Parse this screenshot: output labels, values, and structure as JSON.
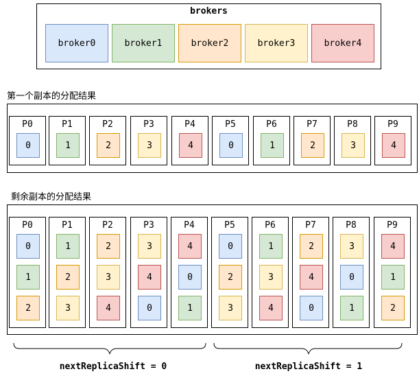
{
  "colors": {
    "0": {
      "fill": "#dae8fc",
      "stroke": "#6c8ebf"
    },
    "1": {
      "fill": "#d5e8d4",
      "stroke": "#82b366"
    },
    "2": {
      "fill": "#ffe6cc",
      "stroke": "#d79b00"
    },
    "3": {
      "fill": "#fff2cc",
      "stroke": "#d6b656"
    },
    "4": {
      "fill": "#f8cecc",
      "stroke": "#b85450"
    }
  },
  "brokers": {
    "title": "brokers",
    "items": [
      {
        "label": "broker0",
        "color": "0"
      },
      {
        "label": "broker1",
        "color": "1"
      },
      {
        "label": "broker2",
        "color": "2"
      },
      {
        "label": "broker3",
        "color": "3"
      },
      {
        "label": "broker4",
        "color": "4"
      }
    ]
  },
  "first_section": {
    "label": "第一个副本的分配结果",
    "partitions": [
      {
        "name": "P0",
        "replicas": [
          "0"
        ]
      },
      {
        "name": "P1",
        "replicas": [
          "1"
        ]
      },
      {
        "name": "P2",
        "replicas": [
          "2"
        ]
      },
      {
        "name": "P3",
        "replicas": [
          "3"
        ]
      },
      {
        "name": "P4",
        "replicas": [
          "4"
        ]
      },
      {
        "name": "P5",
        "replicas": [
          "0"
        ]
      },
      {
        "name": "P6",
        "replicas": [
          "1"
        ]
      },
      {
        "name": "P7",
        "replicas": [
          "2"
        ]
      },
      {
        "name": "P8",
        "replicas": [
          "3"
        ]
      },
      {
        "name": "P9",
        "replicas": [
          "4"
        ]
      }
    ]
  },
  "rest_section": {
    "label": "剩余副本的分配结果",
    "partitions": [
      {
        "name": "P0",
        "replicas": [
          "0",
          "1",
          "2"
        ]
      },
      {
        "name": "P1",
        "replicas": [
          "1",
          "2",
          "3"
        ]
      },
      {
        "name": "P2",
        "replicas": [
          "2",
          "3",
          "4"
        ]
      },
      {
        "name": "P3",
        "replicas": [
          "3",
          "4",
          "0"
        ]
      },
      {
        "name": "P4",
        "replicas": [
          "4",
          "0",
          "1"
        ]
      },
      {
        "name": "P5",
        "replicas": [
          "0",
          "2",
          "3"
        ]
      },
      {
        "name": "P6",
        "replicas": [
          "1",
          "3",
          "4"
        ]
      },
      {
        "name": "P7",
        "replicas": [
          "2",
          "4",
          "0"
        ]
      },
      {
        "name": "P8",
        "replicas": [
          "3",
          "0",
          "1"
        ]
      },
      {
        "name": "P9",
        "replicas": [
          "4",
          "1",
          "2"
        ]
      }
    ]
  },
  "shifts": [
    {
      "label": "nextReplicaShift = 0"
    },
    {
      "label": "nextReplicaShift = 1"
    }
  ]
}
